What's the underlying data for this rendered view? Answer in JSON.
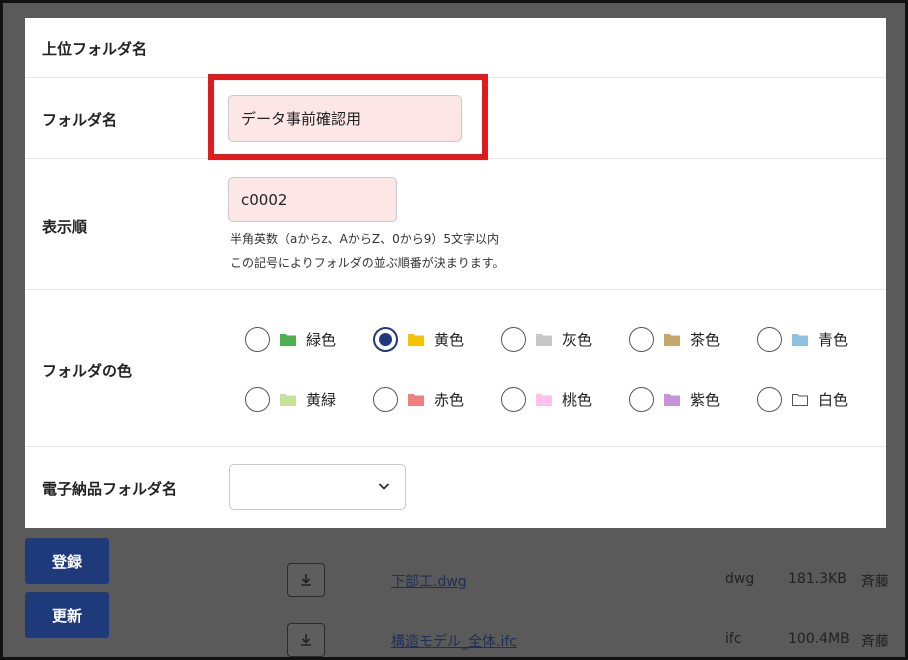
{
  "background": {
    "buttons": {
      "register": "登録",
      "update": "更新"
    },
    "rows": [
      {
        "file": "下部工.dwg",
        "ext": "dwg",
        "size": "181.3KB",
        "user": "斉藤"
      },
      {
        "file": "構造モデル_全体.ifc",
        "ext": "ifc",
        "size": "100.4MB",
        "user": "斉藤"
      }
    ]
  },
  "modal": {
    "parent_folder_label": "上位フォルダ名",
    "folder_name_label": "フォルダ名",
    "folder_name_value": "データ事前確認用",
    "display_order_label": "表示順",
    "display_order_value": "c0002",
    "display_order_hint1": "半角英数（aからz、AからZ、0から9）5文字以内",
    "display_order_hint2": "この記号によりフォルダの並ぶ順番が決まります。",
    "folder_color_label": "フォルダの色",
    "colors": [
      {
        "label": "緑色",
        "hex": "#4caf50",
        "checked": false
      },
      {
        "label": "黄色",
        "hex": "#f5c400",
        "checked": true
      },
      {
        "label": "灰色",
        "hex": "#c8c8c8",
        "checked": false
      },
      {
        "label": "茶色",
        "hex": "#c9a66b",
        "checked": false
      },
      {
        "label": "青色",
        "hex": "#8ec3e6",
        "checked": false
      },
      {
        "label": "黄緑",
        "hex": "#c5e19a",
        "checked": false
      },
      {
        "label": "赤色",
        "hex": "#f08080",
        "checked": false
      },
      {
        "label": "桃色",
        "hex": "#ffc2ee",
        "checked": false
      },
      {
        "label": "紫色",
        "hex": "#c993d9",
        "checked": false
      },
      {
        "label": "白色",
        "hex": "#ffffff",
        "checked": false
      }
    ],
    "e_delivery_label": "電子納品フォルダ名",
    "e_delivery_value": ""
  },
  "accent": "#1f3a7a",
  "highlight_color": "#e01b1b"
}
